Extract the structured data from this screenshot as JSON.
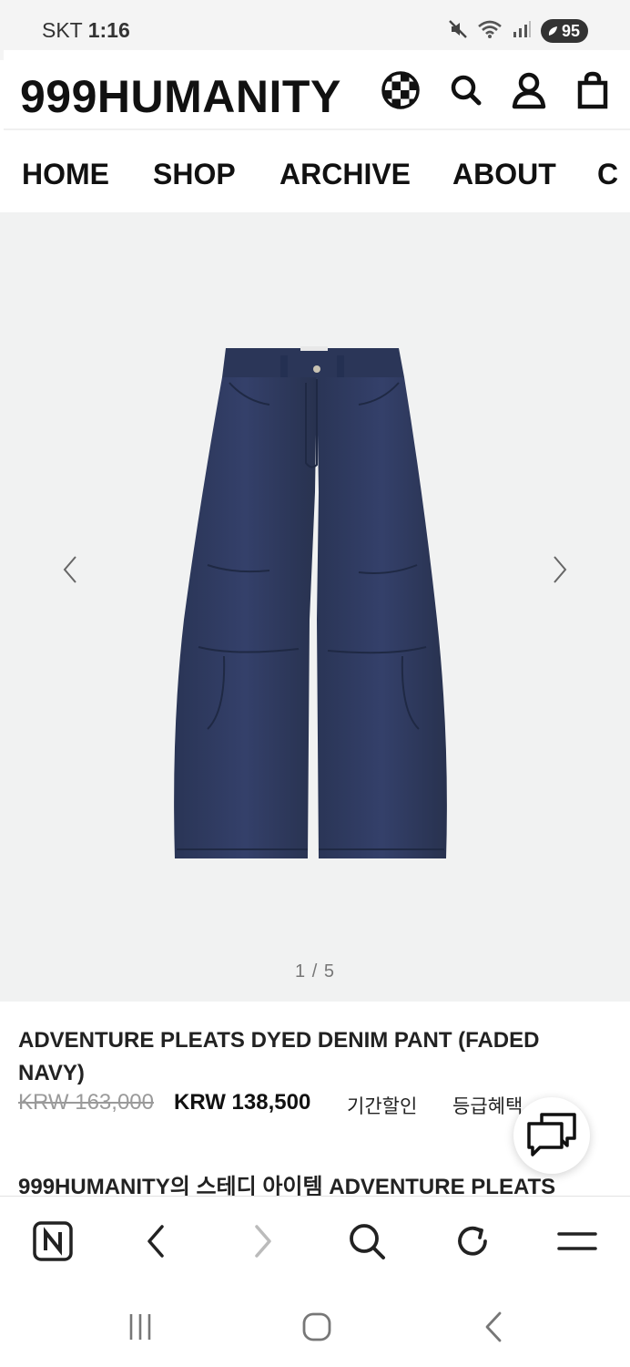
{
  "status_bar": {
    "carrier": "SKT",
    "time": "1:16",
    "battery": "95",
    "icons": [
      "mute-icon",
      "wifi-icon",
      "signal-icon",
      "battery-icon"
    ]
  },
  "header": {
    "logo": "999HUMANITY",
    "icons": [
      "checker-globe-icon",
      "search-icon",
      "user-icon",
      "shopping-bag-icon"
    ]
  },
  "nav": {
    "items": [
      "HOME",
      "SHOP",
      "ARCHIVE",
      "ABOUT",
      "C"
    ]
  },
  "gallery": {
    "image_alt": "navy denim pants",
    "pager": "1 / 5",
    "prev_icon": "chevron-left-icon",
    "next_icon": "chevron-right-icon"
  },
  "product": {
    "title": "ADVENTURE PLEATS DYED DENIM PANT (FADED NAVY)",
    "price_original": "KRW 163,000",
    "price_sale": "KRW 138,500",
    "promo_period": "기간할인",
    "promo_grade": "등급혜택",
    "description": "999HUMANITY의 스테디 아이템 ADVENTURE PLEATS"
  },
  "chat": {
    "icon": "chat-bubbles-icon"
  },
  "toolbar": {
    "icons": [
      "naver-home-icon",
      "back-icon",
      "forward-icon",
      "search-icon",
      "refresh-icon",
      "menu-icon"
    ]
  },
  "android_nav": {
    "icons": [
      "recents-icon",
      "home-icon",
      "back-icon"
    ]
  },
  "colors": {
    "denim": "#2f3a5c",
    "gallery_bg": "#f1f2f2",
    "text": "#111111"
  }
}
